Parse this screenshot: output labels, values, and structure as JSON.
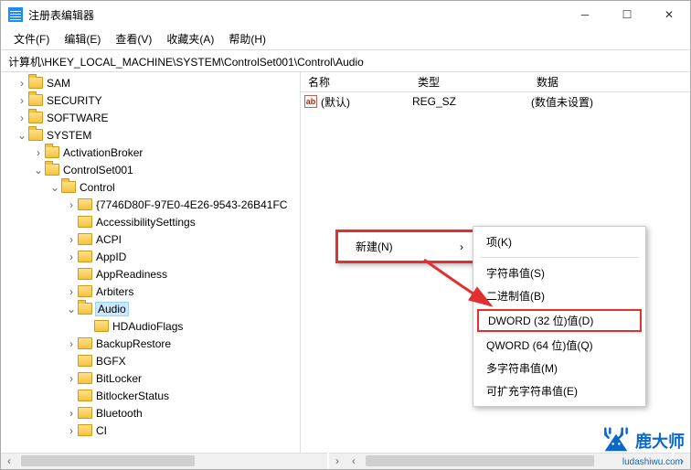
{
  "window": {
    "title": "注册表编辑器"
  },
  "menu": {
    "file": "文件(F)",
    "edit": "编辑(E)",
    "view": "查看(V)",
    "fav": "收藏夹(A)",
    "help": "帮助(H)"
  },
  "address": "计算机\\HKEY_LOCAL_MACHINE\\SYSTEM\\ControlSet001\\Control\\Audio",
  "tree": {
    "sam": "SAM",
    "security": "SECURITY",
    "software": "SOFTWARE",
    "system": "SYSTEM",
    "activationbroker": "ActivationBroker",
    "controlset001": "ControlSet001",
    "control": "Control",
    "guid": "{7746D80F-97E0-4E26-9543-26B41FC",
    "accessibility": "AccessibilitySettings",
    "acpi": "ACPI",
    "appid": "AppID",
    "appreadiness": "AppReadiness",
    "arbiters": "Arbiters",
    "audio": "Audio",
    "hdaudioflags": "HDAudioFlags",
    "backuprestore": "BackupRestore",
    "bgfx": "BGFX",
    "bitlocker": "BitLocker",
    "bitlockerstatus": "BitlockerStatus",
    "bluetooth": "Bluetooth",
    "ci": "CI"
  },
  "list": {
    "hdr_name": "名称",
    "hdr_type": "类型",
    "hdr_data": "数据",
    "row_name": "(默认)",
    "row_type": "REG_SZ",
    "row_data": "(数值未设置)"
  },
  "ctx": {
    "new": "新建(N)",
    "key": "项(K)",
    "string": "字符串值(S)",
    "binary": "二进制值(B)",
    "dword": "DWORD (32 位)值(D)",
    "qword": "QWORD (64 位)值(Q)",
    "multi": "多字符串值(M)",
    "expand": "可扩充字符串值(E)"
  },
  "watermark": {
    "brand": "鹿大师",
    "url": "ludashiwu.com"
  }
}
